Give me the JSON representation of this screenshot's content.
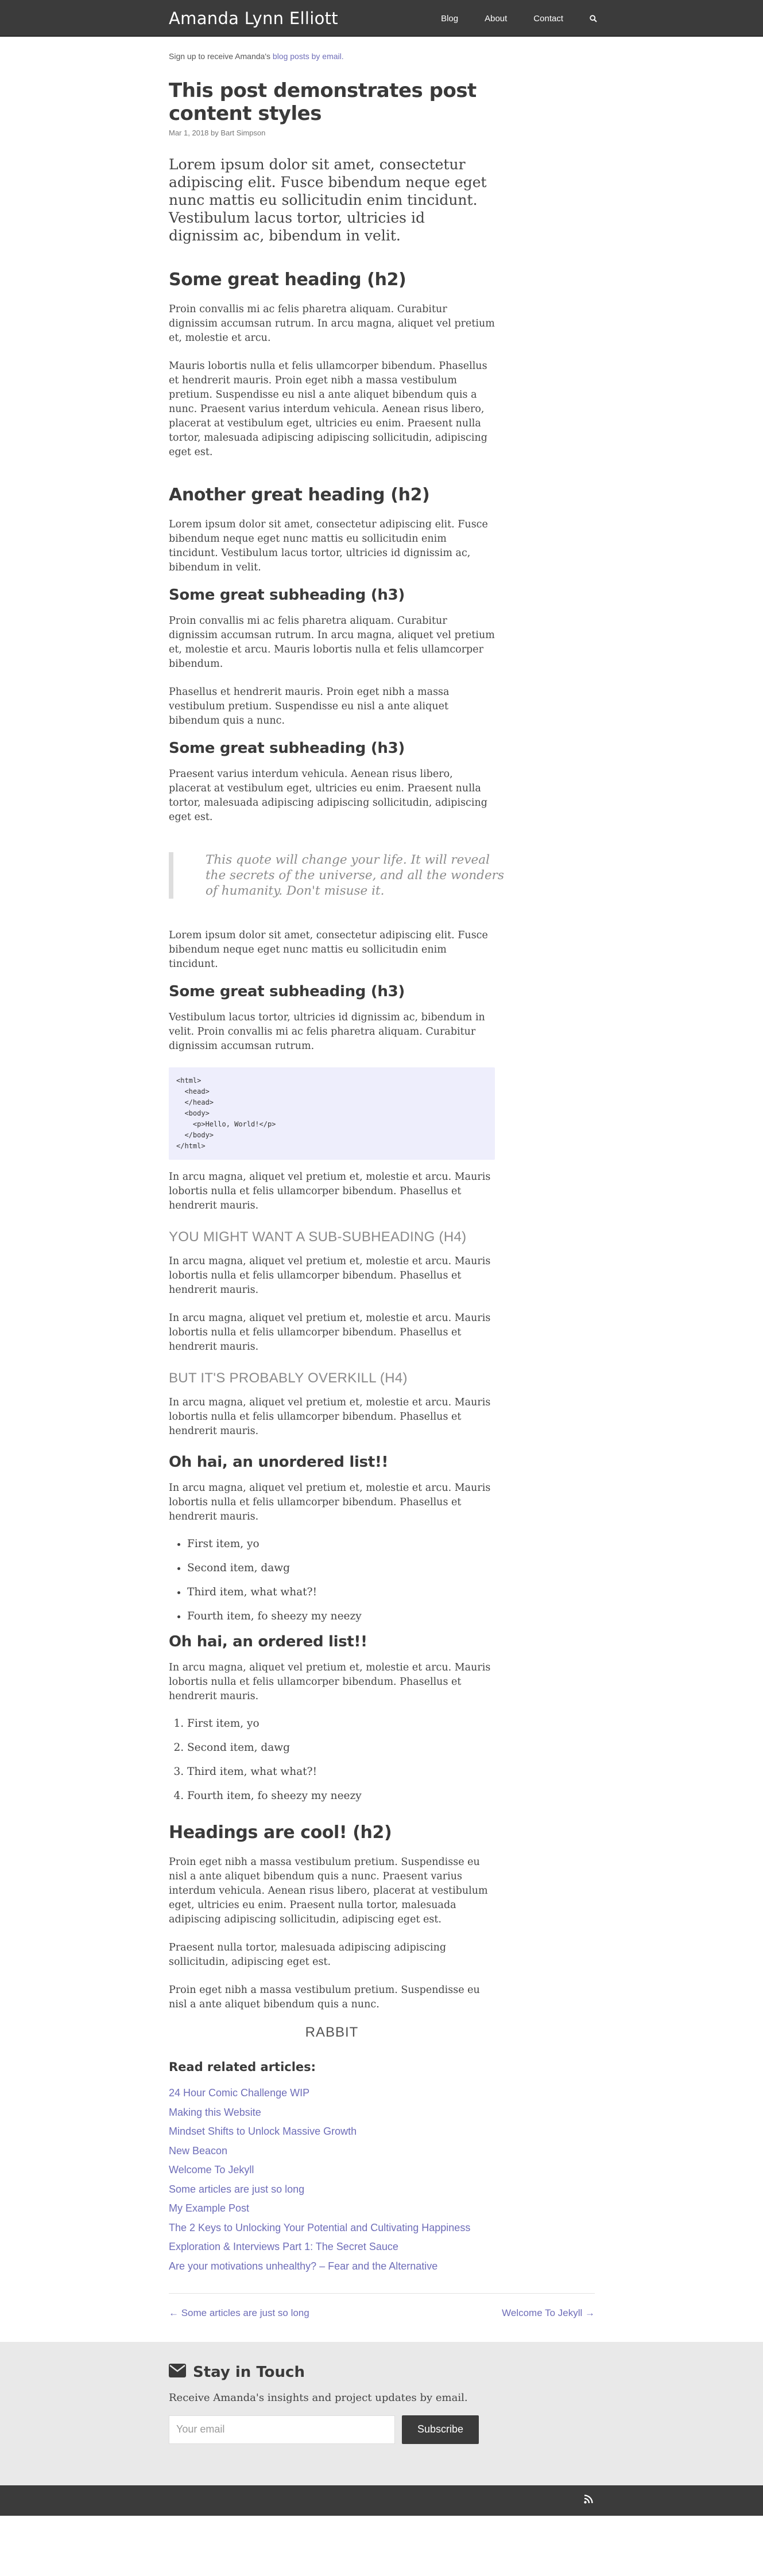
{
  "header": {
    "brand": "Amanda Lynn Elliott",
    "nav": [
      "Blog",
      "About",
      "Contact"
    ]
  },
  "signup": {
    "text": "Sign up to receive Amanda's ",
    "link": "blog posts by email."
  },
  "post": {
    "title": "This post demonstrates post content styles",
    "meta": "Mar 1, 2018 by Bart Simpson",
    "lead": "Lorem ipsum dolor sit amet, consectetur adipiscing elit. Fusce bibendum neque eget nunc mattis eu sollicitudin enim tincidunt. Vestibulum lacus tortor, ultricies id dignissim ac, bibendum in velit.",
    "h2_1": "Some great heading (h2)",
    "p1": "Proin convallis mi ac felis pharetra aliquam. Curabitur dignissim accumsan rutrum. In arcu magna, aliquet vel pretium et, molestie et arcu.",
    "p2": "Mauris lobortis nulla et felis ullamcorper bibendum. Phasellus et hendrerit mauris. Proin eget nibh a massa vestibulum pretium. Suspendisse eu nisl a ante aliquet bibendum quis a nunc. Praesent varius interdum vehicula. Aenean risus libero, placerat at vestibulum eget, ultricies eu enim. Praesent nulla tortor, malesuada adipiscing adipiscing sollicitudin, adipiscing eget est.",
    "h2_2": "Another great heading (h2)",
    "p3": "Lorem ipsum dolor sit amet, consectetur adipiscing elit. Fusce bibendum neque eget nunc mattis eu sollicitudin enim tincidunt. Vestibulum lacus tortor, ultricies id dignissim ac, bibendum in velit.",
    "h3_1": "Some great subheading (h3)",
    "p4": "Proin convallis mi ac felis pharetra aliquam. Curabitur dignissim accumsan rutrum. In arcu magna, aliquet vel pretium et, molestie et arcu. Mauris lobortis nulla et felis ullamcorper bibendum.",
    "p5": "Phasellus et hendrerit mauris. Proin eget nibh a massa vestibulum pretium. Suspendisse eu nisl a ante aliquet bibendum quis a nunc.",
    "h3_2": "Some great subheading (h3)",
    "p6": "Praesent varius interdum vehicula. Aenean risus libero, placerat at vestibulum eget, ultricies eu enim. Praesent nulla tortor, malesuada adipiscing adipiscing sollicitudin, adipiscing eget est.",
    "quote": "This quote will change your life. It will reveal the secrets of the universe, and all the wonders of humanity. Don't misuse it.",
    "p7": "Lorem ipsum dolor sit amet, consectetur adipiscing elit. Fusce bibendum neque eget nunc mattis eu sollicitudin enim tincidunt.",
    "h3_3": "Some great subheading (h3)",
    "p8": "Vestibulum lacus tortor, ultricies id dignissim ac, bibendum in velit. Proin convallis mi ac felis pharetra aliquam. Curabitur dignissim accumsan rutrum.",
    "code": "<html>\n  <head>\n  </head>\n  <body>\n    <p>Hello, World!</p>\n  </body>\n</html>",
    "p9": "In arcu magna, aliquet vel pretium et, molestie et arcu. Mauris lobortis nulla et felis ullamcorper bibendum. Phasellus et hendrerit mauris.",
    "h4_1": "YOU MIGHT WANT A SUB-SUBHEADING (H4)",
    "p10": "In arcu magna, aliquet vel pretium et, molestie et arcu. Mauris lobortis nulla et felis ullamcorper bibendum. Phasellus et hendrerit mauris.",
    "p11": "In arcu magna, aliquet vel pretium et, molestie et arcu. Mauris lobortis nulla et felis ullamcorper bibendum. Phasellus et hendrerit mauris.",
    "h4_2": "BUT IT'S PROBABLY OVERKILL (H4)",
    "p12": "In arcu magna, aliquet vel pretium et, molestie et arcu. Mauris lobortis nulla et felis ullamcorper bibendum. Phasellus et hendrerit mauris.",
    "h3_ul": "Oh hai, an unordered list!!",
    "p13": "In arcu magna, aliquet vel pretium et, molestie et arcu. Mauris lobortis nulla et felis ullamcorper bibendum. Phasellus et hendrerit mauris.",
    "ul": [
      "First item, yo",
      "Second item, dawg",
      "Third item, what what?!",
      "Fourth item, fo sheezy my neezy"
    ],
    "h3_ol": "Oh hai, an ordered list!!",
    "p14": "In arcu magna, aliquet vel pretium et, molestie et arcu. Mauris lobortis nulla et felis ullamcorper bibendum. Phasellus et hendrerit mauris.",
    "ol": [
      "First item, yo",
      "Second item, dawg",
      "Third item, what what?!",
      "Fourth item, fo sheezy my neezy"
    ],
    "h2_3": "Headings are cool! (h2)",
    "p15": "Proin eget nibh a massa vestibulum pretium. Suspendisse eu nisl a ante aliquet bibendum quis a nunc. Praesent varius interdum vehicula. Aenean risus libero, placerat at vestibulum eget, ultricies eu enim. Praesent nulla tortor, malesuada adipiscing adipiscing sollicitudin, adipiscing eget est.",
    "p16": "Praesent nulla tortor, malesuada adipiscing adipiscing sollicitudin, adipiscing eget est.",
    "p17": "Proin eget nibh a massa vestibulum pretium. Suspendisse eu nisl a ante aliquet bibendum quis a nunc.",
    "rabbit": "RABBIT"
  },
  "related": {
    "title": "Read related articles:",
    "items": [
      "24 Hour Comic Challenge WIP",
      "Making this Website",
      "Mindset Shifts to Unlock Massive Growth",
      "New Beacon",
      "Welcome To Jekyll",
      "Some articles are just so long",
      "My Example Post",
      "The 2 Keys to Unlocking Your Potential and Cultivating Happiness",
      "Exploration & Interviews Part 1: The Secret Sauce",
      "Are your motivations unhealthy? – Fear and the Alternative"
    ]
  },
  "pager": {
    "prev": "← Some articles are just so long",
    "next": "Welcome To Jekyll →"
  },
  "footer": {
    "title": "Stay in Touch",
    "desc": "Receive Amanda's insights and project updates by email.",
    "placeholder": "Your email",
    "button": "Subscribe"
  },
  "icons": {
    "search": "search-icon",
    "envelope": "envelope-icon",
    "rss": "rss-icon"
  },
  "colors": {
    "header_bg": "#3b3b3b",
    "link": "#6e6db8",
    "code_bg": "#eeeefc",
    "footer_bg": "#e9e9e9"
  }
}
